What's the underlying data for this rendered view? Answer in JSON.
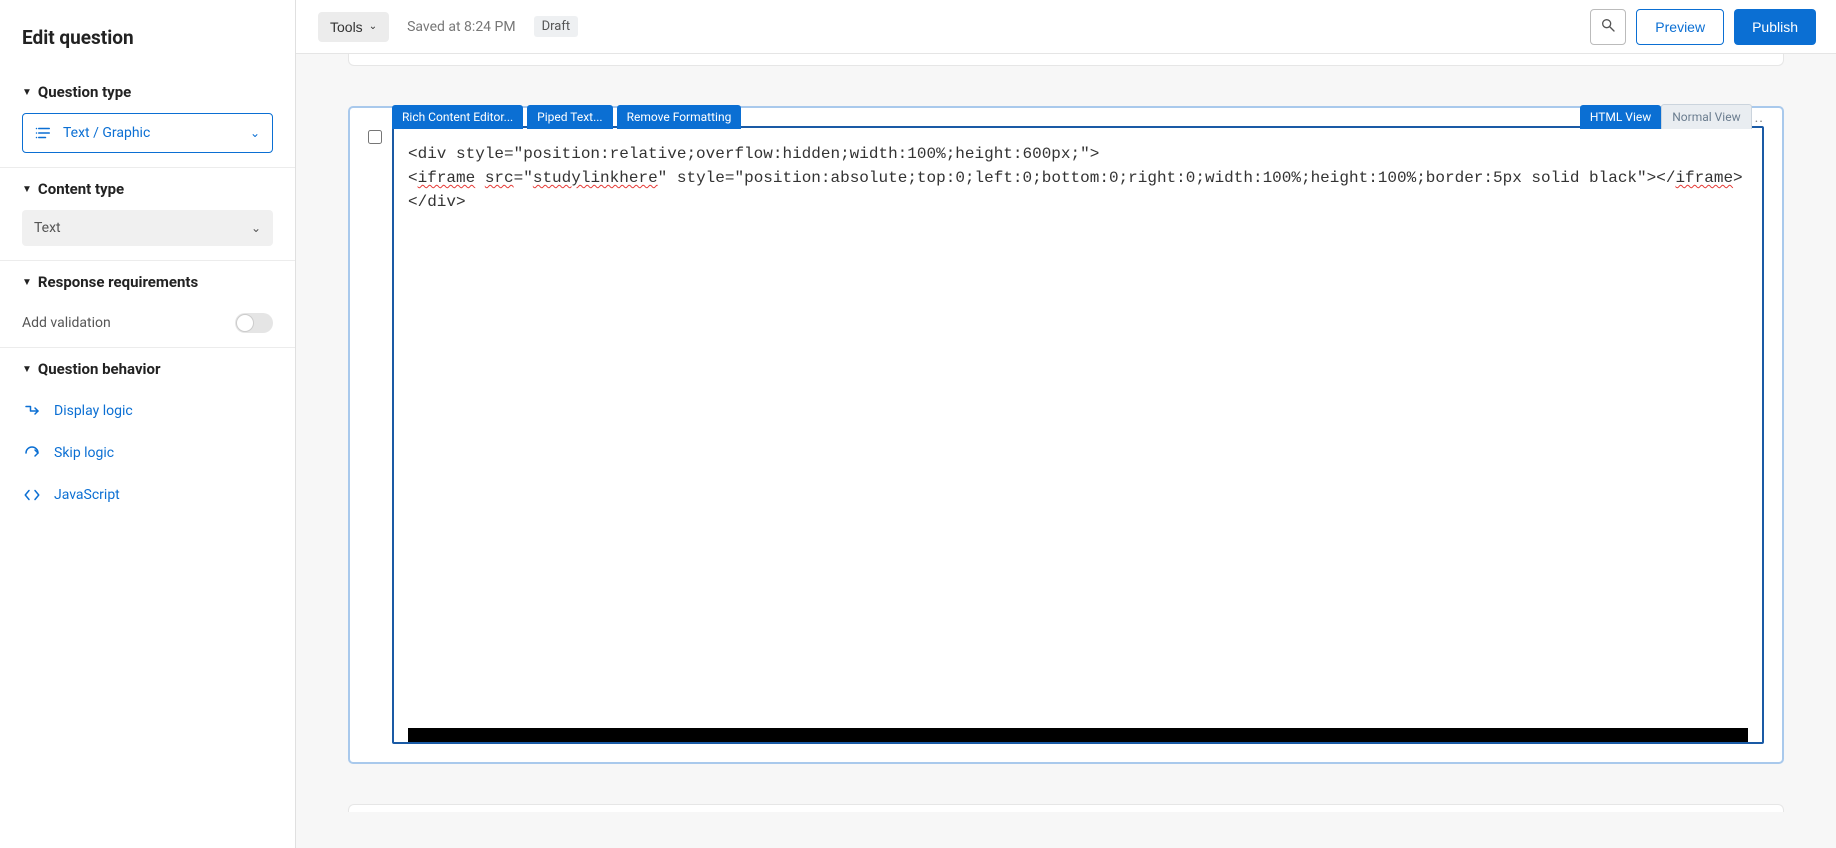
{
  "sidebar": {
    "title": "Edit question",
    "question_type": {
      "heading": "Question type",
      "selected": "Text / Graphic"
    },
    "content_type": {
      "heading": "Content type",
      "selected": "Text"
    },
    "response_req": {
      "heading": "Response requirements",
      "validation_label": "Add validation"
    },
    "behavior": {
      "heading": "Question behavior",
      "items": [
        "Display logic",
        "Skip logic",
        "JavaScript"
      ]
    }
  },
  "toolbar": {
    "tools_label": "Tools",
    "saved_text": "Saved at 8:24 PM",
    "draft_label": "Draft",
    "preview_label": "Preview",
    "publish_label": "Publish"
  },
  "editor": {
    "tabs_left": [
      "Rich Content Editor...",
      "Piped Text...",
      "Remove Formatting"
    ],
    "tabs_right": [
      "HTML View",
      "Normal View"
    ],
    "dots": "..",
    "code_line1_a": "<div style=\"position:relative;overflow:hidden;width:100%;height:600px;\">",
    "code_line2_a": "<",
    "code_line2_b": "iframe",
    "code_line2_c": " ",
    "code_line2_d": "src",
    "code_line2_e": "=\"",
    "code_line2_f": "studylinkhere",
    "code_line2_g": "\" style=\"position:absolute;top:0;left:0;bottom:0;right:0;width:100%;height:100%;border:5px solid black\"></",
    "code_line2_h": "iframe",
    "code_line2_i": ">",
    "code_line3_a": "</div>"
  }
}
